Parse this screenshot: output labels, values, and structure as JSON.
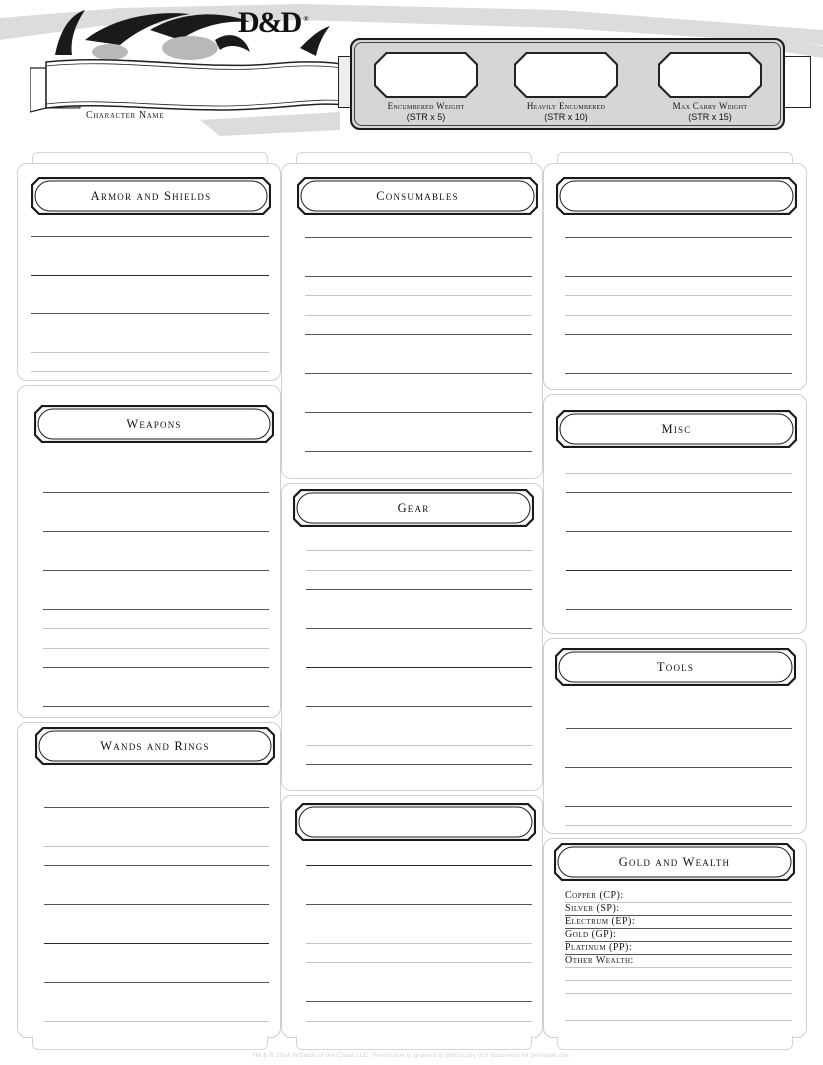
{
  "header": {
    "logo": "D&D",
    "logo_mark": "®",
    "character_name_label": "Character Name",
    "character_name_value": "",
    "weights": [
      {
        "label": "Encumbered Weight",
        "formula": "(STR x 5)",
        "value": ""
      },
      {
        "label": "Heavily Encumbered",
        "formula": "(STR x 10)",
        "value": ""
      },
      {
        "label": "Max Carry Weight",
        "formula": "(STR x 15)",
        "value": ""
      }
    ]
  },
  "sections": {
    "armor": {
      "title": "Armor and Shields"
    },
    "weapons": {
      "title": "Weapons"
    },
    "wands": {
      "title": "Wands and Rings"
    },
    "consumables": {
      "title": "Consumables"
    },
    "gear": {
      "title": "Gear"
    },
    "blank_middle": {
      "title": ""
    },
    "blank_right": {
      "title": ""
    },
    "misc": {
      "title": "Misc"
    },
    "tools": {
      "title": "Tools"
    },
    "gold": {
      "title": "Gold and Wealth",
      "rows": [
        {
          "label": "Copper (CP):",
          "value": ""
        },
        {
          "label": "Silver (SP):",
          "value": ""
        },
        {
          "label": "Electrum (EP):",
          "value": ""
        },
        {
          "label": "Gold (GP):",
          "value": ""
        },
        {
          "label": "Platinum (PP):",
          "value": ""
        },
        {
          "label": "Other Wealth:",
          "value": ""
        }
      ]
    }
  },
  "footer": "TM & © 2014 Wizards of the Coast LLC. Permission is granted to photocopy this document for personal use.",
  "colors": {
    "ink": "#1a1a1a",
    "panel_border": "#cfcfcf",
    "weight_panel_bg": "#d6d6d6",
    "rule_dark": "#555555",
    "rule_light": "#c4c4c4"
  }
}
